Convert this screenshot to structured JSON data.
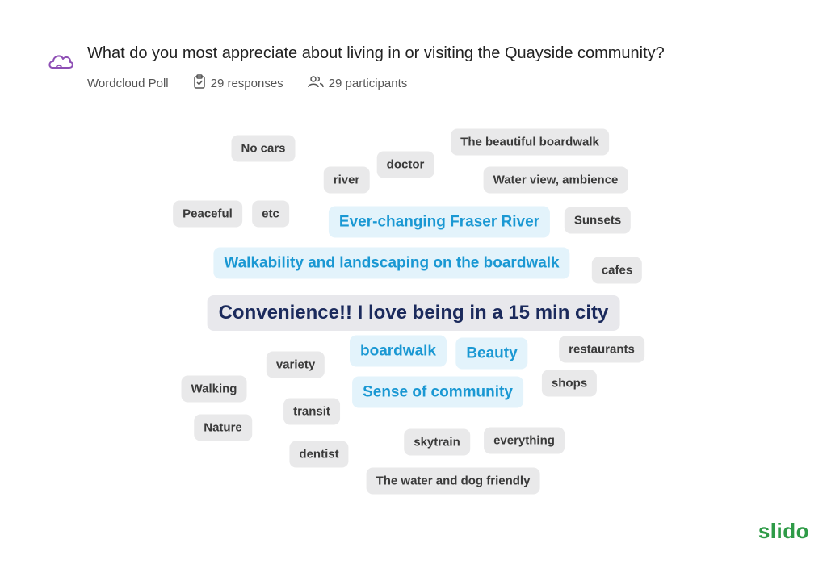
{
  "header": {
    "question": "What do you most appreciate about living in or visiting the Quayside community?",
    "poll_type": "Wordcloud Poll",
    "responses": "29 responses",
    "participants": "29 participants"
  },
  "words": [
    {
      "text": "No cars",
      "size": "s"
    },
    {
      "text": "doctor",
      "size": "s"
    },
    {
      "text": "The beautiful boardwalk",
      "size": "s"
    },
    {
      "text": "river",
      "size": "s"
    },
    {
      "text": "Water view, ambience",
      "size": "s"
    },
    {
      "text": "Peaceful",
      "size": "s"
    },
    {
      "text": "etc",
      "size": "s"
    },
    {
      "text": "Ever-changing Fraser River",
      "size": "m"
    },
    {
      "text": "Sunsets",
      "size": "s"
    },
    {
      "text": "Walkability and landscaping on the boardwalk",
      "size": "m"
    },
    {
      "text": "cafes",
      "size": "s"
    },
    {
      "text": "Convenience!! I love being in a 15 min city",
      "size": "l"
    },
    {
      "text": "boardwalk",
      "size": "m"
    },
    {
      "text": "Beauty",
      "size": "m"
    },
    {
      "text": "restaurants",
      "size": "s"
    },
    {
      "text": "variety",
      "size": "s"
    },
    {
      "text": "shops",
      "size": "s"
    },
    {
      "text": "Walking",
      "size": "s"
    },
    {
      "text": "Sense of community",
      "size": "m"
    },
    {
      "text": "transit",
      "size": "s"
    },
    {
      "text": "Nature",
      "size": "s"
    },
    {
      "text": "skytrain",
      "size": "s"
    },
    {
      "text": "everything",
      "size": "s"
    },
    {
      "text": "dentist",
      "size": "s"
    },
    {
      "text": "The water and dog friendly",
      "size": "s"
    }
  ],
  "brand": {
    "logo_text": "slido",
    "accent_color": "#2e9b47",
    "highlight_color": "#1a98d3",
    "primary_word_color": "#1b2a5c"
  }
}
